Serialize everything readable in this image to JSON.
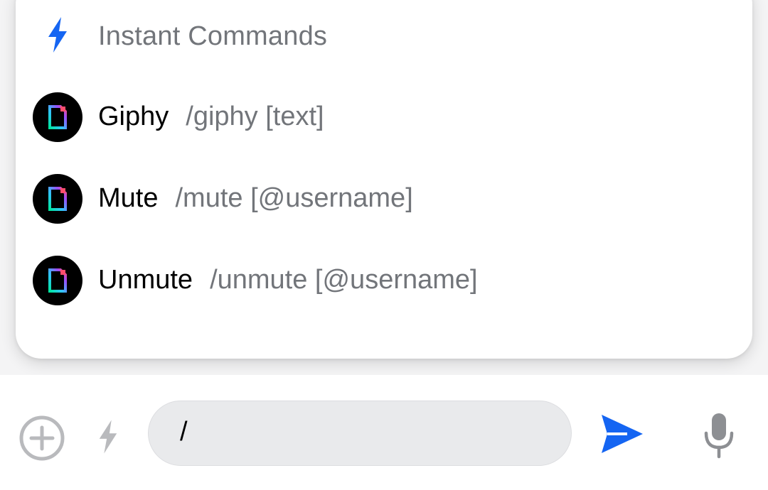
{
  "popup": {
    "title": "Instant Commands",
    "commands": [
      {
        "name": "Giphy",
        "args": "/giphy [text]"
      },
      {
        "name": "Mute",
        "args": "/mute [@username]"
      },
      {
        "name": "Unmute",
        "args": "/unmute [@username]"
      }
    ]
  },
  "composer": {
    "input_value": "/"
  },
  "colors": {
    "accent": "#1565f2",
    "muted_icon": "#b9babd",
    "secondary_text": "#72757a"
  },
  "icons": {
    "header": "lightning-bolt-icon",
    "command": "command-file-icon",
    "attach": "plus-circle-icon",
    "commands_toggle": "lightning-bolt-icon",
    "send": "send-icon",
    "mic": "microphone-icon"
  }
}
